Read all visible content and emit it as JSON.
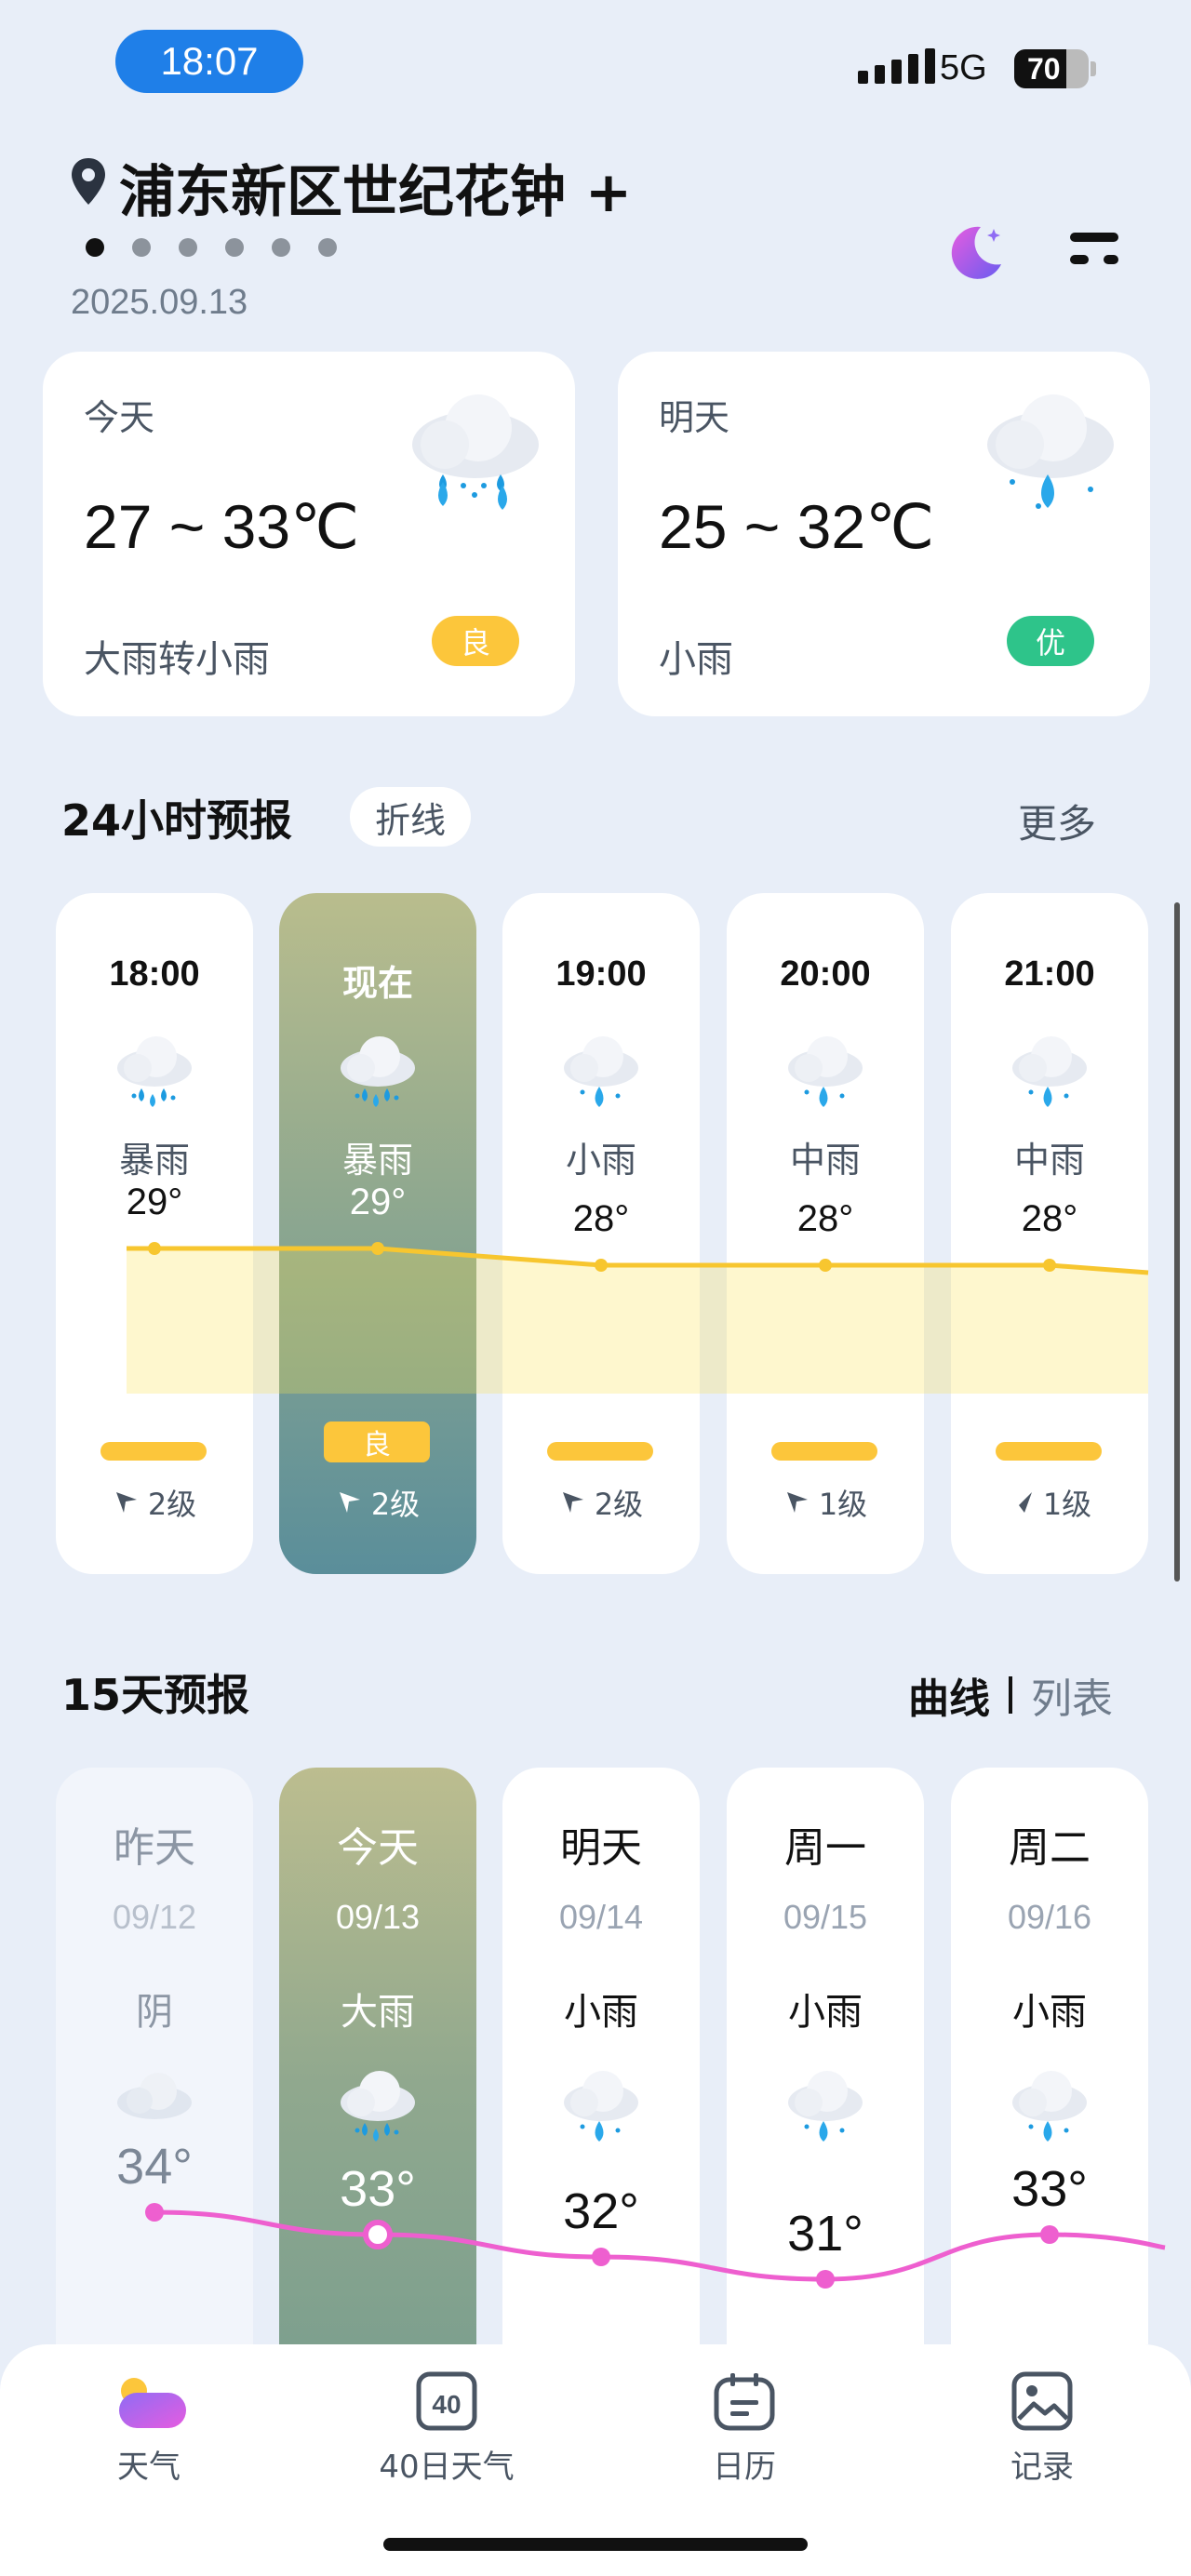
{
  "status": {
    "time": "18:07",
    "network": "5G",
    "battery": "70",
    "battery_level": 0.7
  },
  "location": {
    "name": "浦东新区世纪花钟 +",
    "date": "2025.09.13",
    "page_count": 6,
    "active_page": 0
  },
  "day_cards": [
    {
      "label": "今天",
      "temp": "27 ~ 33℃",
      "desc": "大雨转小雨",
      "aqi": "良",
      "aqi_color": "#fcc63b",
      "icon": "heavy-rain-icon"
    },
    {
      "label": "明天",
      "temp": "25 ~ 32℃",
      "desc": "小雨",
      "aqi": "优",
      "aqi_color": "#2ec48a",
      "icon": "light-rain-icon"
    }
  ],
  "hourly": {
    "title": "24小时预报",
    "mode_chip": "折线",
    "more": "更多",
    "items": [
      {
        "time": "18:00",
        "weather": "暴雨",
        "temp": "29°",
        "temp_value": 29,
        "aqi": "",
        "wind": "2级",
        "now": false
      },
      {
        "time": "现在",
        "weather": "暴雨",
        "temp": "29°",
        "temp_value": 29,
        "aqi": "良",
        "wind": "2级",
        "now": true
      },
      {
        "time": "19:00",
        "weather": "小雨",
        "temp": "28°",
        "temp_value": 28,
        "aqi": "",
        "wind": "2级",
        "now": false
      },
      {
        "time": "20:00",
        "weather": "中雨",
        "temp": "28°",
        "temp_value": 28,
        "aqi": "",
        "wind": "1级",
        "now": false
      },
      {
        "time": "21:00",
        "weather": "中雨",
        "temp": "28°",
        "temp_value": 28,
        "aqi": "",
        "wind": "1级",
        "now": false
      }
    ]
  },
  "daily": {
    "title": "15天预报",
    "view_curve": "曲线",
    "view_list": "列表",
    "items": [
      {
        "name": "昨天",
        "date": "09/12",
        "weather": "阴",
        "high": "34°",
        "high_value": 34
      },
      {
        "name": "今天",
        "date": "09/13",
        "weather": "大雨",
        "high": "33°",
        "high_value": 33
      },
      {
        "name": "明天",
        "date": "09/14",
        "weather": "小雨",
        "high": "32°",
        "high_value": 32
      },
      {
        "name": "周一",
        "date": "09/15",
        "weather": "小雨",
        "high": "31°",
        "high_value": 31
      },
      {
        "name": "周二",
        "date": "09/16",
        "weather": "小雨",
        "high": "33°",
        "high_value": 33
      }
    ]
  },
  "nav": [
    {
      "label": "天气",
      "icon": "weather-icon"
    },
    {
      "label": "40日天气",
      "icon": "forty-day-icon",
      "badge": "40"
    },
    {
      "label": "日历",
      "icon": "calendar-icon"
    },
    {
      "label": "记录",
      "icon": "gallery-icon"
    }
  ]
}
